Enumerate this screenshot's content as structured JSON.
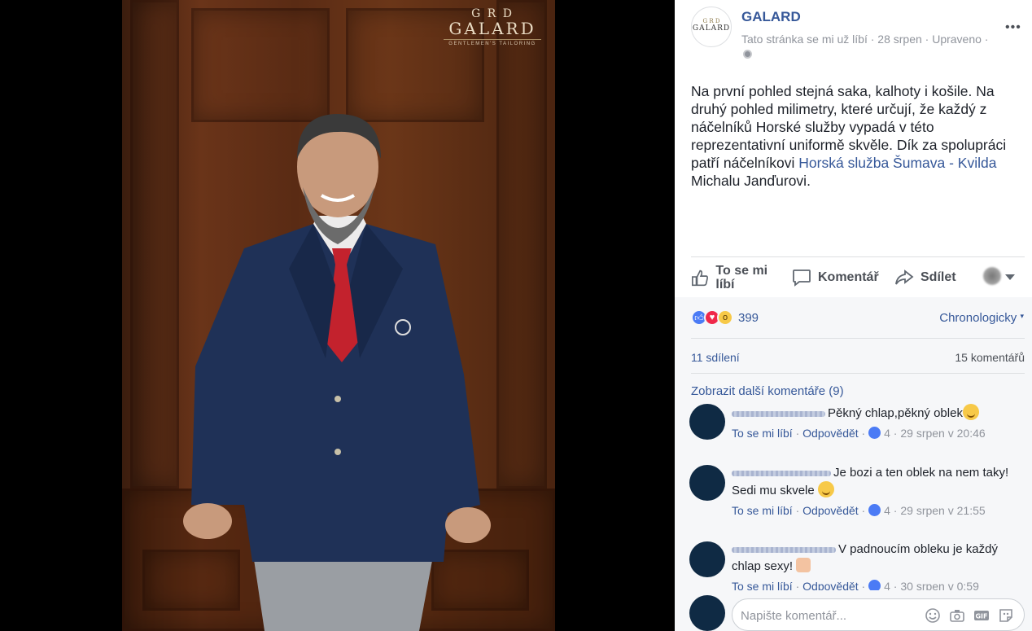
{
  "photo": {
    "watermark": {
      "monogram": "G R D",
      "brand": "GALARD",
      "tagline": "GENTLEMEN'S TAILORING"
    }
  },
  "post": {
    "page_name": "GALARD",
    "avatar": {
      "monogram": "G R D",
      "brand": "GALARD"
    },
    "meta": "Tato stránka se mi už líbí · 28 srpen · Upraveno ·",
    "more_icon": "more-icon",
    "text_1": "Na první pohled stejná saka, kalhoty i košile. Na druhý pohled milimetry, které určují, že každý z náčelníků Horské služby vypadá v této reprezentativní uniformě skvěle. Dík za spolupráci patří náčelníkovi ",
    "text_link": "Horská služba Šumava - Kvilda",
    "text_2": " Michalu Janďurovi."
  },
  "actions": {
    "like": "To se mi líbí",
    "comment": "Komentář",
    "share": "Sdílet"
  },
  "stats": {
    "reaction_count": "399",
    "order_label": "Chronologicky",
    "shares": "11 sdílení",
    "comments_count": "15 komentářů",
    "more_comments": "Zobrazit další komentáře (9)"
  },
  "comments": [
    {
      "text": "Pěkný chlap,pěkný oblek",
      "like": "To se mi líbí",
      "reply": "Odpovědět",
      "likes": "4",
      "time": "29 srpen v 20:46"
    },
    {
      "text": "Je bozi a ten oblek na nem taky! Sedi mu skvele",
      "like": "To se mi líbí",
      "reply": "Odpovědět",
      "likes": "4",
      "time": "29 srpen v 21:55"
    },
    {
      "text": "V padnoucím obleku je každý chlap sexy!",
      "like": "To se mi líbí",
      "reply": "Odpovědět",
      "likes": "4",
      "time": "30 srpen v 0:59"
    }
  ],
  "composer": {
    "placeholder": "Napište komentář..."
  },
  "colors": {
    "link": "#365899",
    "muted": "#90949c",
    "text": "#1d2129",
    "like_blue": "#4b7bf5",
    "love_red": "#f0284a"
  }
}
